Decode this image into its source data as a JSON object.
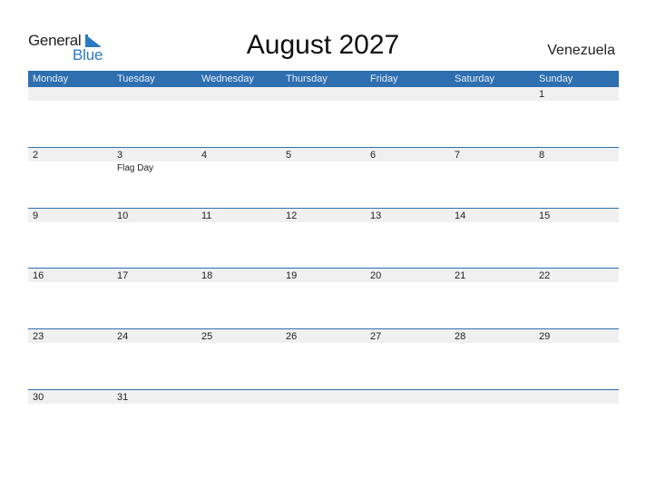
{
  "logo": {
    "line1": "General",
    "line2": "Blue",
    "brand_color": "#2a7ac2"
  },
  "header": {
    "title": "August 2027",
    "country": "Venezuela"
  },
  "colors": {
    "header_bg": "#2e6fb0",
    "strip_bg": "#f0f0f0"
  },
  "weekdays": [
    "Monday",
    "Tuesday",
    "Wednesday",
    "Thursday",
    "Friday",
    "Saturday",
    "Sunday"
  ],
  "weeks": [
    [
      {
        "day": ""
      },
      {
        "day": ""
      },
      {
        "day": ""
      },
      {
        "day": ""
      },
      {
        "day": ""
      },
      {
        "day": ""
      },
      {
        "day": "1"
      }
    ],
    [
      {
        "day": "2"
      },
      {
        "day": "3",
        "holiday": "Flag Day"
      },
      {
        "day": "4"
      },
      {
        "day": "5"
      },
      {
        "day": "6"
      },
      {
        "day": "7"
      },
      {
        "day": "8"
      }
    ],
    [
      {
        "day": "9"
      },
      {
        "day": "10"
      },
      {
        "day": "11"
      },
      {
        "day": "12"
      },
      {
        "day": "13"
      },
      {
        "day": "14"
      },
      {
        "day": "15"
      }
    ],
    [
      {
        "day": "16"
      },
      {
        "day": "17"
      },
      {
        "day": "18"
      },
      {
        "day": "19"
      },
      {
        "day": "20"
      },
      {
        "day": "21"
      },
      {
        "day": "22"
      }
    ],
    [
      {
        "day": "23"
      },
      {
        "day": "24"
      },
      {
        "day": "25"
      },
      {
        "day": "26"
      },
      {
        "day": "27"
      },
      {
        "day": "28"
      },
      {
        "day": "29"
      }
    ],
    [
      {
        "day": "30"
      },
      {
        "day": "31"
      },
      {
        "day": ""
      },
      {
        "day": ""
      },
      {
        "day": ""
      },
      {
        "day": ""
      },
      {
        "day": ""
      }
    ]
  ]
}
